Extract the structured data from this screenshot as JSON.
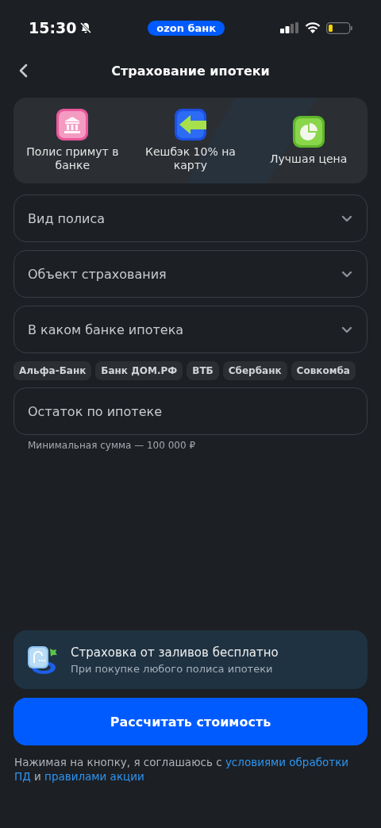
{
  "status_bar": {
    "time": "15:30",
    "badge": "ozon банк"
  },
  "header": {
    "title": "Страхование ипотеки"
  },
  "benefits": [
    {
      "kind": "bank",
      "label": "Полис примут в банке"
    },
    {
      "kind": "cashback",
      "label": "Кешбэк 10% на карту"
    },
    {
      "kind": "price",
      "label": "Лучшая цена"
    }
  ],
  "selects": [
    {
      "placeholder": "Вид полиса"
    },
    {
      "placeholder": "Объект страхования"
    },
    {
      "placeholder": "В каком банке ипотека"
    }
  ],
  "bank_chips": [
    "Альфа-Банк",
    "Банк ДОМ.РФ",
    "ВТБ",
    "Сбербанк",
    "Совкомба"
  ],
  "balance_field": {
    "placeholder": "Остаток по ипотеке",
    "hint": "Минимальная сумма — 100 000 ₽"
  },
  "promo": {
    "title": "Страховка от заливов бесплатно",
    "subtitle": "При покупке любого полиса ипотеки"
  },
  "button": "Рассчитать стоимость",
  "consent": [
    {
      "kind": "text",
      "text": "Нажимая на кнопку, я соглашаюсь с "
    },
    {
      "kind": "link",
      "text": "условиями обработки"
    },
    {
      "kind": "link",
      "text": "ПД"
    },
    {
      "kind": "text",
      "text": " и "
    },
    {
      "kind": "link",
      "text": "правилами акции"
    }
  ]
}
